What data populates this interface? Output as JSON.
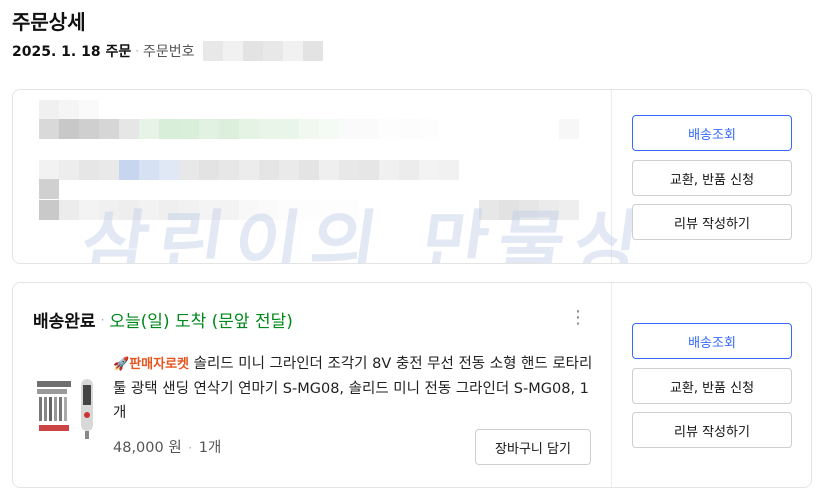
{
  "header": {
    "title": "주문상세",
    "order_date": "2025. 1. 18 주문",
    "order_no_label": "주문번호"
  },
  "order1": {
    "watermark": "삼린이의 만물상",
    "buttons": {
      "track": "배송조회",
      "exchange": "교환, 반품 신청",
      "review": "리뷰 작성하기"
    }
  },
  "order2": {
    "status": "배송완료",
    "arrival": "오늘(일) 도착 (문앞 전달)",
    "product": {
      "badge": "판매자로켓",
      "title": "솔리드 미니 그라인더 조각기 8V 충전 무선 전동 소형 핸드 로타리툴 광택 샌딩 연삭기 연마기 S-MG08, 솔리드 미니 전동 그라인더 S-MG08, 1개",
      "price": "48,000 원",
      "quantity": "1개",
      "cart_button": "장바구니 담기"
    },
    "buttons": {
      "track": "배송조회",
      "exchange": "교환, 반품 신청",
      "review": "리뷰 작성하기"
    }
  },
  "colors": {
    "accent": "#346aff",
    "arrival": "#00891a",
    "rocket": "#e8541e"
  },
  "icons": {
    "more": "more-vertical-icon",
    "rocket": "rocket-icon"
  }
}
